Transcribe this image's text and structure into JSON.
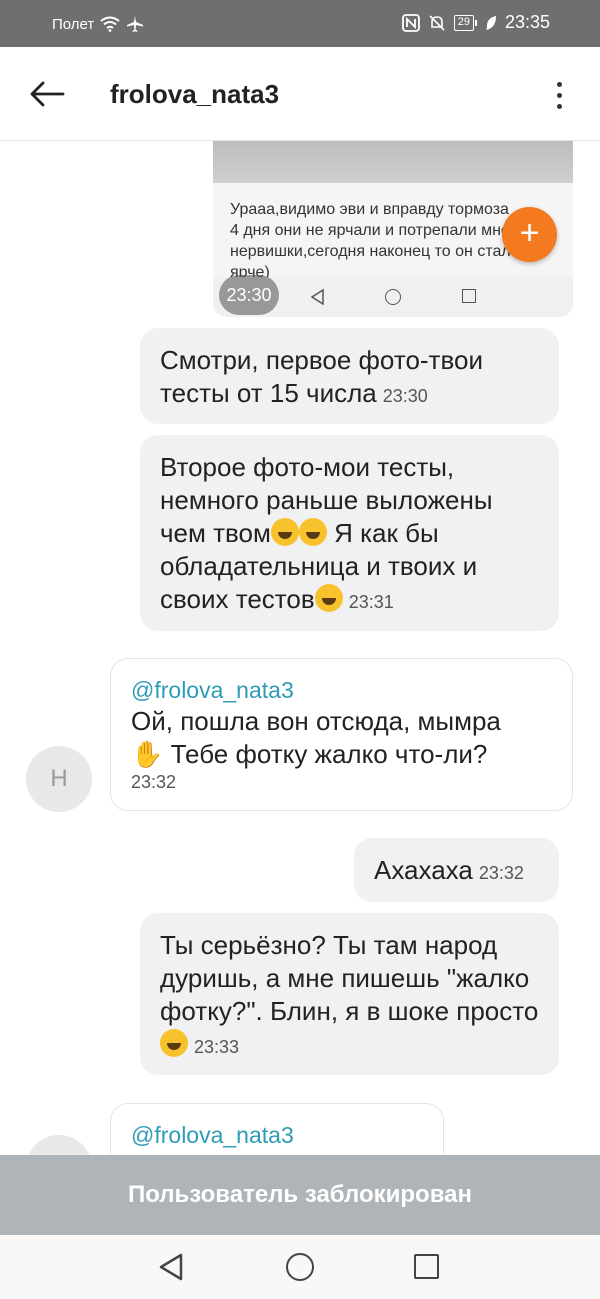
{
  "status_bar": {
    "carrier": "Полет",
    "battery": "29",
    "time": "23:35"
  },
  "header": {
    "title": "frolova_nata3"
  },
  "screenshot_message": {
    "text": "Урааа,видимо эви и вправду тормоза 4 дня они не ярчали и потрепали мне нервишки,сегодня наконец то он стал ярче)",
    "time": "23:30",
    "fab_label": "+"
  },
  "messages": [
    {
      "text": "Смотри, первое фото-твои тесты от 15 числа",
      "time": "23:30"
    },
    {
      "text": "Второе фото-мои тесты, немного раньше выложены чем твом",
      "text_after": " Я как бы обладательница и твоих и своих тестов",
      "time": "23:31"
    },
    {
      "mention": "@frolova_nata3",
      "text": "Ой, пошла вон отсюда, мымра",
      "text_after": " Тебе фотку жалко что-ли?",
      "time": "23:32",
      "avatar": "Н"
    },
    {
      "text": "Ахахаха",
      "time": "23:32"
    },
    {
      "text": "Ты серьёзно? Ты там народ дуришь, а мне пишешь \"жалко фотку?\". Блин, я в шоке просто",
      "time": "23:33"
    },
    {
      "mention": "@frolova_nata3"
    }
  ],
  "blocked_bar": {
    "text": "Пользователь заблокирован"
  },
  "colors": {
    "accent": "#2e9cb6",
    "fab": "#f47a1f",
    "blocked": "#aeb4b7"
  }
}
